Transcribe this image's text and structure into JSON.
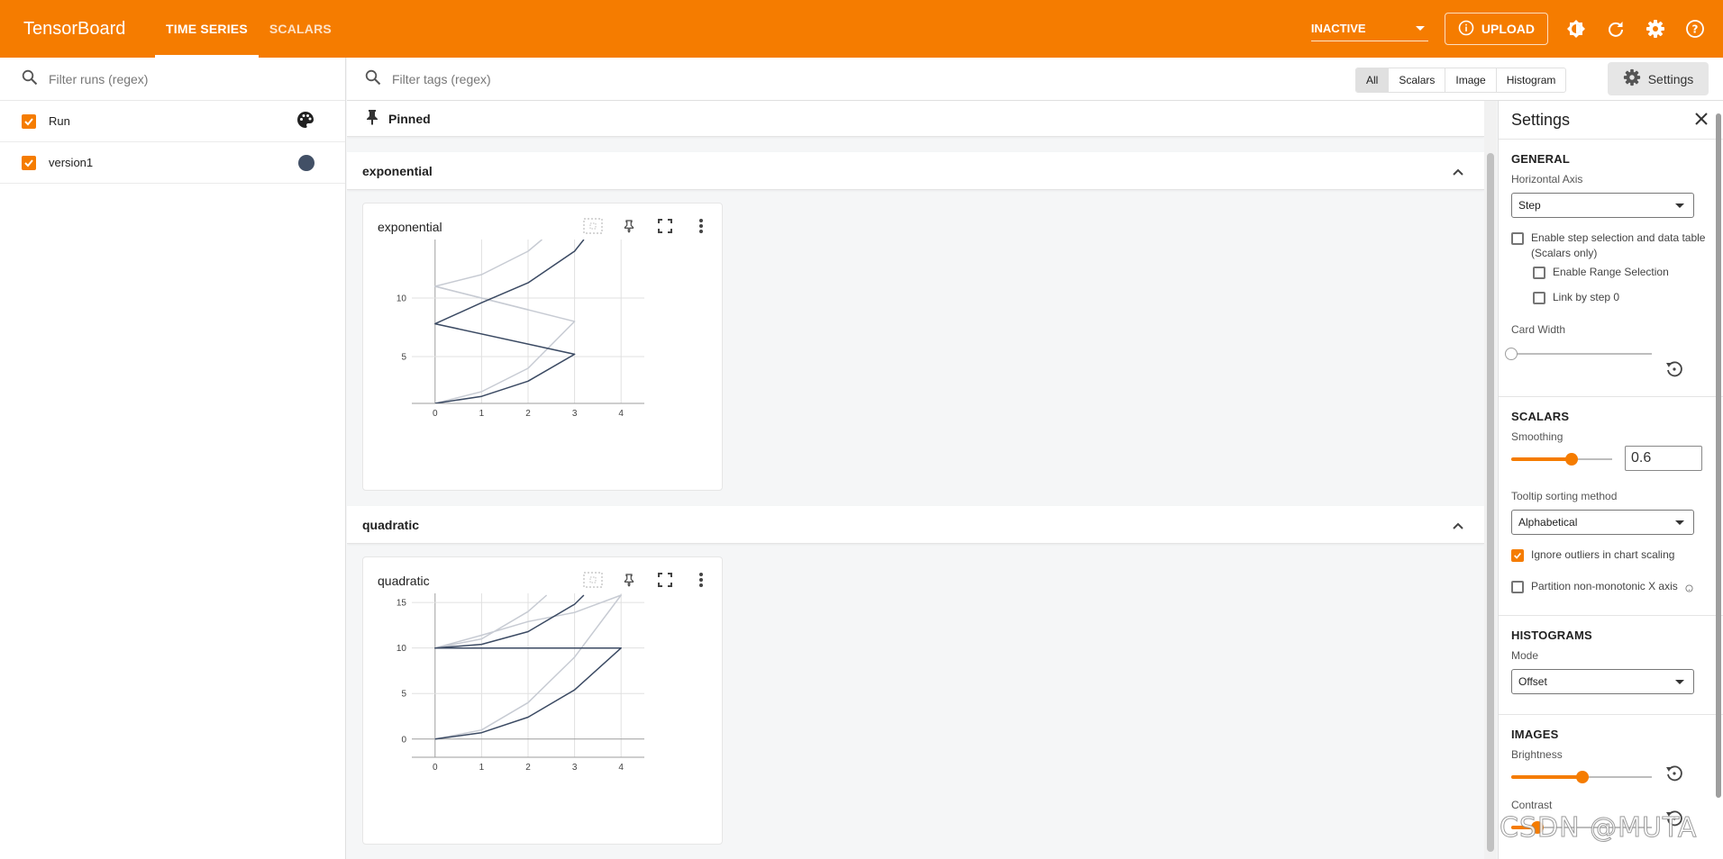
{
  "app": {
    "brand": "TensorBoard"
  },
  "header": {
    "tabs": [
      {
        "label": "TIME SERIES",
        "active": true
      },
      {
        "label": "SCALARS",
        "active": false
      }
    ],
    "status": "INACTIVE",
    "upload_label": "UPLOAD",
    "icons": [
      "info-icon",
      "theme-toggle-icon",
      "refresh-icon",
      "gear-icon",
      "help-icon"
    ],
    "colors": {
      "accent": "#f57c00"
    }
  },
  "runs": {
    "filter_placeholder": "Filter runs (regex)",
    "items": [
      {
        "label": "Run",
        "checked": true,
        "icon": "palette-icon"
      },
      {
        "label": "version1",
        "checked": true,
        "color": "#425066"
      }
    ]
  },
  "main": {
    "tag_filter_placeholder": "Filter tags (regex)",
    "type_filters": [
      "All",
      "Scalars",
      "Image",
      "Histogram"
    ],
    "active_type": "All",
    "settings_button": "Settings",
    "pinned_label": "Pinned",
    "groups": [
      {
        "name": "exponential",
        "card_title": "exponential"
      },
      {
        "name": "quadratic",
        "card_title": "quadratic"
      }
    ]
  },
  "settings": {
    "title": "Settings",
    "general": {
      "title": "GENERAL",
      "horizontal_axis_label": "Horizontal Axis",
      "horizontal_axis_value": "Step",
      "step_selection_label": "Enable step selection and data table",
      "step_selection_sub": "(Scalars only)",
      "range_selection_label": "Enable Range Selection",
      "link_step_label": "Link by step 0",
      "card_width_label": "Card Width"
    },
    "scalars": {
      "title": "SCALARS",
      "smoothing_label": "Smoothing",
      "smoothing_value": "0.6",
      "tooltip_label": "Tooltip sorting method",
      "tooltip_value": "Alphabetical",
      "ignore_outliers_label": "Ignore outliers in chart scaling",
      "ignore_outliers_checked": true,
      "partition_label": "Partition non-monotonic X axis"
    },
    "histograms": {
      "title": "HISTOGRAMS",
      "mode_label": "Mode",
      "mode_value": "Offset"
    },
    "images": {
      "title": "IMAGES",
      "brightness_label": "Brightness",
      "contrast_label": "Contrast"
    }
  },
  "watermark": "CSDN @MUTA",
  "chart_data": [
    {
      "type": "line",
      "title": "exponential",
      "xlim": [
        -0.5,
        4.5
      ],
      "ylim": [
        1,
        15
      ],
      "xticks": [
        0,
        1,
        2,
        3,
        4
      ],
      "yticks": [
        5,
        10
      ],
      "series": [
        {
          "color": "#3b4a63",
          "points": [
            [
              0,
              1
            ],
            [
              1,
              1.6
            ],
            [
              2,
              2.9
            ],
            [
              3,
              5.2
            ],
            [
              0,
              7.8
            ],
            [
              1,
              9.6
            ],
            [
              2,
              11.3
            ],
            [
              3,
              14
            ],
            [
              3.2,
              15
            ]
          ]
        },
        {
          "color": "#c7cbd3",
          "points": [
            [
              0,
              1
            ],
            [
              1,
              2
            ],
            [
              2,
              4
            ],
            [
              3,
              8
            ],
            [
              0,
              11
            ],
            [
              1,
              12
            ],
            [
              2,
              14
            ],
            [
              2.3,
              15
            ]
          ]
        },
        {
          "color": "#c7cbd3",
          "points": [
            [
              0,
              11
            ],
            [
              1,
              10
            ],
            [
              2,
              9
            ]
          ]
        }
      ]
    },
    {
      "type": "line",
      "title": "quadratic",
      "xlim": [
        -0.5,
        4.5
      ],
      "ylim": [
        -2,
        16
      ],
      "xticks": [
        0,
        1,
        2,
        3,
        4
      ],
      "yticks": [
        0,
        5,
        10,
        15
      ],
      "series": [
        {
          "color": "#3b4a63",
          "points": [
            [
              0,
              0
            ],
            [
              1,
              0.7
            ],
            [
              2,
              2.4
            ],
            [
              3,
              5.4
            ],
            [
              4,
              10
            ],
            [
              0,
              10
            ],
            [
              1,
              10.4
            ],
            [
              2,
              11.8
            ],
            [
              3,
              14.8
            ],
            [
              3.2,
              15.8
            ]
          ]
        },
        {
          "color": "#c7cbd3",
          "points": [
            [
              0,
              0
            ],
            [
              1,
              1
            ],
            [
              2,
              4
            ],
            [
              3,
              9
            ],
            [
              4,
              15.8
            ],
            [
              3,
              13.9
            ],
            [
              2,
              12.9
            ],
            [
              1,
              11.4
            ],
            [
              0,
              10
            ],
            [
              1,
              11
            ],
            [
              2,
              14
            ],
            [
              2.4,
              15.8
            ]
          ]
        }
      ]
    }
  ]
}
